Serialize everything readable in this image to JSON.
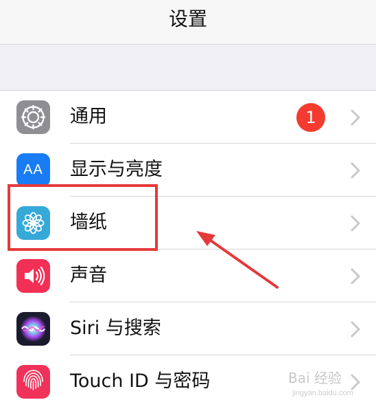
{
  "header": {
    "title": "设置"
  },
  "settings": {
    "items": [
      {
        "label": "通用",
        "icon": "gear-icon",
        "icon_bg": "#8e8e93",
        "badge": "1"
      },
      {
        "label": "显示与亮度",
        "icon": "display-brightness-icon",
        "icon_bg": "#1a7cf5",
        "icon_text": "AA"
      },
      {
        "label": "墙纸",
        "icon": "wallpaper-flower-icon",
        "icon_bg": "#35a9d8"
      },
      {
        "label": "声音",
        "icon": "speaker-icon",
        "icon_bg": "#f22f55"
      },
      {
        "label": "Siri 与搜索",
        "icon": "siri-icon",
        "icon_bg": "#1b1b2e"
      },
      {
        "label": "Touch ID 与密码",
        "icon": "fingerprint-icon",
        "icon_bg": "#f0325a"
      }
    ]
  },
  "annotation": {
    "highlight_color": "#e5393a",
    "highlighted_item": "墙纸"
  },
  "watermark": {
    "text": "Bai 经验",
    "sub": "jingyan.baidu.com"
  },
  "colors": {
    "badge": "#f43b2f",
    "chevron": "#c7c7cc",
    "background": "#efeff4"
  }
}
